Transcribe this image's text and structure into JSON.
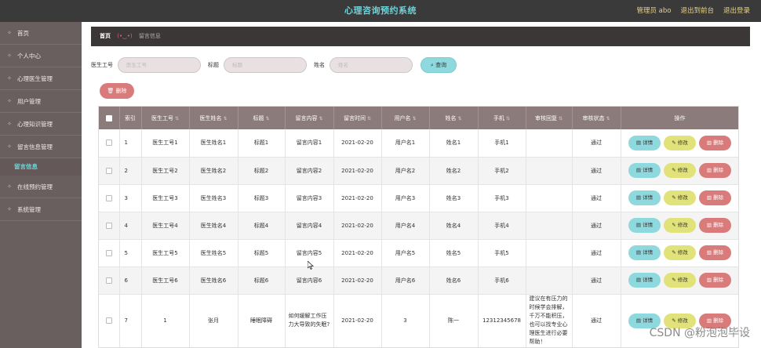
{
  "header": {
    "title": "心理咨询预约系统",
    "admin_label": "管理员 abo",
    "back_label": "退出到前台",
    "logout_label": "退出登录"
  },
  "sidebar": {
    "items": [
      {
        "label": "首页"
      },
      {
        "label": "个人中心"
      },
      {
        "label": "心理医生管理"
      },
      {
        "label": "用户管理"
      },
      {
        "label": "心理知识管理"
      },
      {
        "label": "留言信息管理"
      },
      {
        "label": "留言信息",
        "active": true
      },
      {
        "label": "在线预约管理"
      },
      {
        "label": "系统管理"
      }
    ]
  },
  "breadcrumb": {
    "home": "首页",
    "face": "(•‿•)",
    "current": "留言信息"
  },
  "search": {
    "doctor_id_label": "医生工号",
    "doctor_id_placeholder": "医生工号",
    "title_label": "标题",
    "title_placeholder": "标题",
    "name_label": "姓名",
    "name_placeholder": "姓名",
    "query_label": "查询"
  },
  "actions": {
    "delete_label": "删除"
  },
  "table": {
    "columns": [
      "索引",
      "医生工号",
      "医生姓名",
      "标题",
      "留言内容",
      "留言时间",
      "用户名",
      "姓名",
      "手机",
      "审核回复",
      "审核状态",
      "操作"
    ],
    "rows": [
      {
        "idx": "1",
        "doc_id": "医生工号1",
        "doc_name": "医生姓名1",
        "title": "标题1",
        "content": "留言内容1",
        "time": "2021-02-20",
        "user": "用户名1",
        "name": "姓名1",
        "phone": "手机1",
        "reply": "",
        "status": "通过"
      },
      {
        "idx": "2",
        "doc_id": "医生工号2",
        "doc_name": "医生姓名2",
        "title": "标题2",
        "content": "留言内容2",
        "time": "2021-02-20",
        "user": "用户名2",
        "name": "姓名2",
        "phone": "手机2",
        "reply": "",
        "status": "通过"
      },
      {
        "idx": "3",
        "doc_id": "医生工号3",
        "doc_name": "医生姓名3",
        "title": "标题3",
        "content": "留言内容3",
        "time": "2021-02-20",
        "user": "用户名3",
        "name": "姓名3",
        "phone": "手机3",
        "reply": "",
        "status": "通过"
      },
      {
        "idx": "4",
        "doc_id": "医生工号4",
        "doc_name": "医生姓名4",
        "title": "标题4",
        "content": "留言内容4",
        "time": "2021-02-20",
        "user": "用户名4",
        "name": "姓名4",
        "phone": "手机4",
        "reply": "",
        "status": "通过"
      },
      {
        "idx": "5",
        "doc_id": "医生工号5",
        "doc_name": "医生姓名5",
        "title": "标题5",
        "content": "留言内容5",
        "time": "2021-02-20",
        "user": "用户名5",
        "name": "姓名5",
        "phone": "手机5",
        "reply": "",
        "status": "通过"
      },
      {
        "idx": "6",
        "doc_id": "医生工号6",
        "doc_name": "医生姓名6",
        "title": "标题6",
        "content": "留言内容6",
        "time": "2021-02-20",
        "user": "用户名6",
        "name": "姓名6",
        "phone": "手机6",
        "reply": "",
        "status": "通过"
      },
      {
        "idx": "7",
        "doc_id": "1",
        "doc_name": "张月",
        "title": "睡眠障碍",
        "content": "如何缓解工作压力大导致的失眠?",
        "time": "2021-02-20",
        "user": "3",
        "name": "陈一",
        "phone": "12312345678",
        "reply": "建议在有压力的时候学会排解，千万不能积压，也可以找专业心理医生进行必要帮助！",
        "status": "通过"
      }
    ],
    "row_buttons": {
      "detail": "详情",
      "edit": "修改",
      "remove": "删除"
    }
  },
  "watermark": "CSDN @粉泡泡毕设"
}
